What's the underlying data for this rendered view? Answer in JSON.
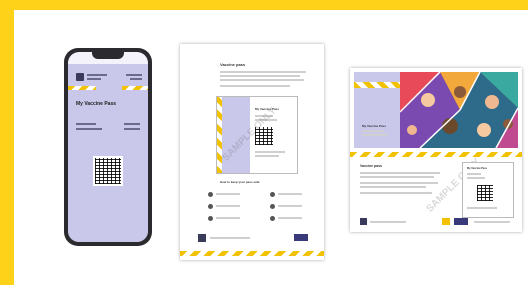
{
  "phone": {
    "card_title": "My Vaccine Pass"
  },
  "letter": {
    "heading": "Vaccine pass",
    "pass_title": "My Vaccine Pass",
    "watermark": "SAMPLE ONLY",
    "section_title": "How to keep your pass safe"
  },
  "cardsheet": {
    "pass_title": "My Vaccine Pass",
    "heading": "Vaccine pass",
    "watermark": "SAMPLE ONLY"
  },
  "colors": {
    "border_yellow": "#ffd21a",
    "stripe_yellow": "#f2c200",
    "card_lavender": "#c9c7ea",
    "phone_body": "#2b2b2f"
  }
}
